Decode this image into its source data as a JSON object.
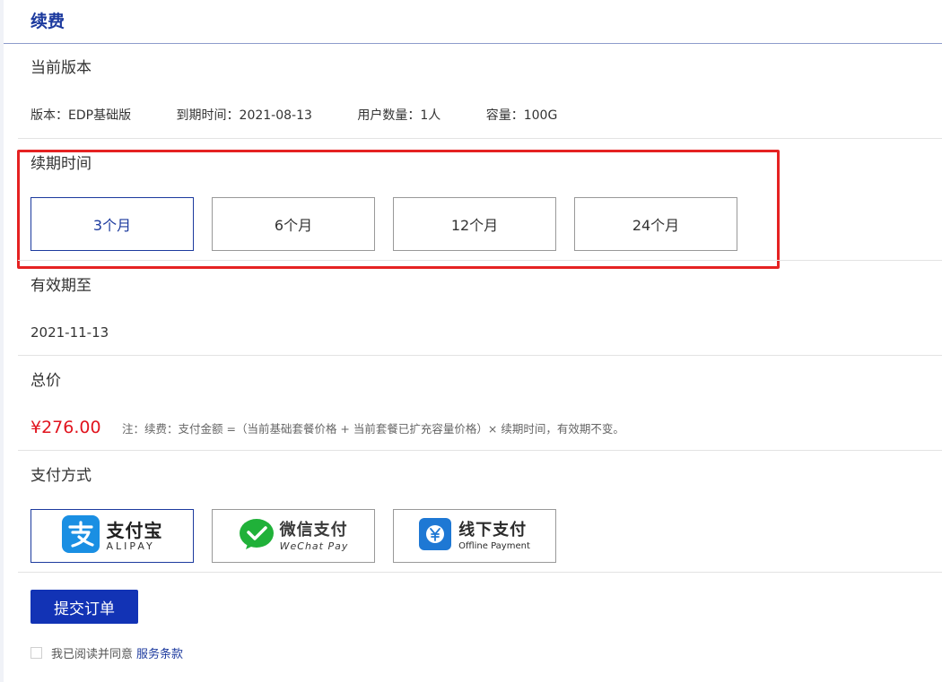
{
  "header": {
    "title": "续费"
  },
  "current_version": {
    "title": "当前版本",
    "version": "版本：EDP基础版",
    "expiry": "到期时间：2021-08-13",
    "users": "用户数量：1人",
    "capacity": "容量：100G"
  },
  "period": {
    "title": "续期时间",
    "options": [
      "3个月",
      "6个月",
      "12个月",
      "24个月"
    ],
    "selected": "3个月",
    "highlight_color": "#e52222"
  },
  "valid_until": {
    "title": "有效期至",
    "date": "2021-11-13"
  },
  "total": {
    "title": "总价",
    "price": "¥276.00",
    "note": "注：续费：支付金额 =（当前基础套餐价格 + 当前套餐已扩充容量价格）× 续期时间，有效期不变。"
  },
  "payment": {
    "title": "支付方式",
    "methods": [
      {
        "name": "支付宝",
        "sub": "ALIPAY",
        "icon": "alipay-icon",
        "color": "#1a8fe3"
      },
      {
        "name": "微信支付",
        "sub": "WeChat Pay",
        "icon": "wechat-pay-icon",
        "color": "#20b139"
      },
      {
        "name": "线下支付",
        "sub": "Offline Payment",
        "icon": "offline-payment-icon",
        "color": "#1e78d4"
      }
    ],
    "selected": "支付宝"
  },
  "submit": {
    "label": "提交订单"
  },
  "agreement": {
    "text": "我已阅读并同意",
    "link": "服务条款",
    "checked": false
  },
  "colors": {
    "primary": "#1c3a9e",
    "button": "#1233b5",
    "price": "#e1141e"
  }
}
